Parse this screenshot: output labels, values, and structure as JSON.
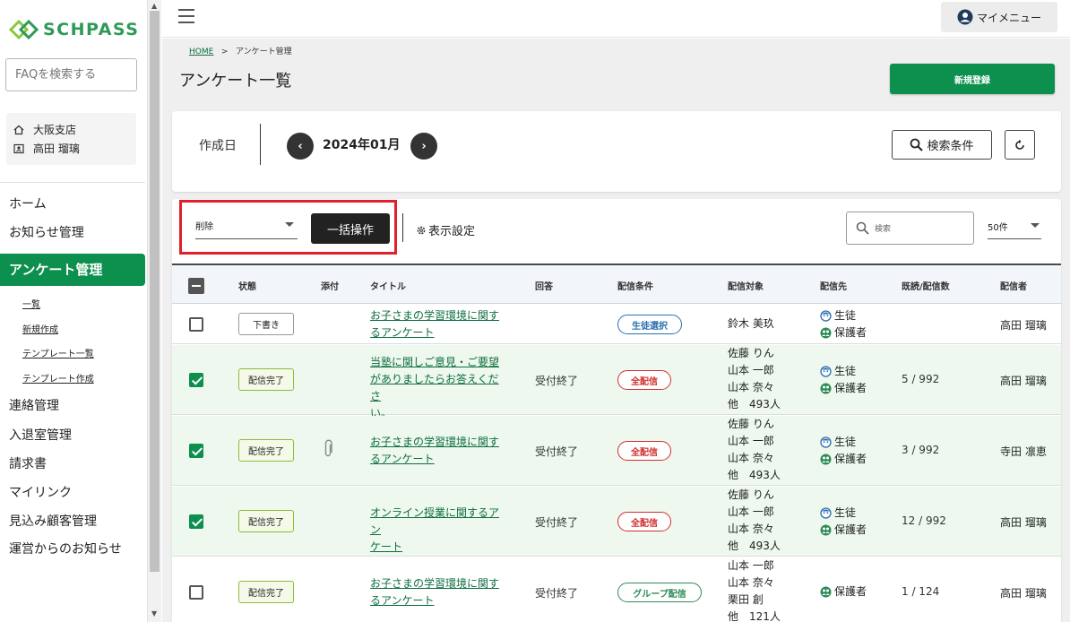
{
  "brand": {
    "name": "SCHPASS",
    "color": "#2f9a57"
  },
  "sidebar": {
    "faq_placeholder": "FAQを検索する",
    "org": {
      "branch": "大阪支店",
      "user": "高田 瑠璃"
    },
    "nav": [
      {
        "label": "ホーム"
      },
      {
        "label": "お知らせ管理"
      },
      {
        "label": "アンケート管理",
        "active": true
      },
      {
        "label": "連絡管理"
      },
      {
        "label": "入退室管理"
      },
      {
        "label": "請求書"
      },
      {
        "label": "マイリンク"
      },
      {
        "label": "見込み顧客管理"
      },
      {
        "label": "運営からのお知らせ"
      }
    ],
    "sub_nav": [
      {
        "label": "一覧"
      },
      {
        "label": "新規作成"
      },
      {
        "label": "テンプレート一覧"
      },
      {
        "label": "テンプレート作成"
      }
    ]
  },
  "topbar": {
    "my_menu_label": "マイメニュー"
  },
  "breadcrumb": {
    "home": "HOME",
    "separator": ">",
    "current": "アンケート管理"
  },
  "page": {
    "title": "アンケート一覧",
    "new_button": "新規登録",
    "accent": "#0d8f4e"
  },
  "filter": {
    "date_label": "作成日",
    "month": "2024年01月",
    "search_conditions_label": "検索条件"
  },
  "list_toolbar": {
    "bulk_action_value": "削除",
    "bulk_button": "一括操作",
    "display_settings": "表示設定",
    "search_placeholder": "検索",
    "per_page": "50件",
    "highlight_color": "#e0202a"
  },
  "table": {
    "headers": [
      "状態",
      "添付",
      "タイトル",
      "回答",
      "配信条件",
      "配信対象",
      "配信先",
      "既読/配信数",
      "配信者"
    ],
    "rows": [
      {
        "checked": false,
        "status": "下書き",
        "attachment": false,
        "title_line1": "お子さまの学習環境に関す",
        "title_line2": "るアンケート",
        "title_line3": "",
        "answer": "",
        "condition": "生徒選択",
        "targets": [
          "鈴木 美玖"
        ],
        "destinations": [
          "生徒",
          "保護者"
        ],
        "reads": "",
        "sender": "高田 瑠璃"
      },
      {
        "checked": true,
        "status": "配信完了",
        "attachment": false,
        "title_line1": "当塾に関しご意見・ご要望",
        "title_line2": "がありましたらお答えくださ",
        "title_line3": "い。",
        "answer": "受付終了",
        "condition": "全配信",
        "targets": [
          "佐藤 りん",
          "山本 一郎",
          "山本 奈々",
          "他　493人"
        ],
        "destinations": [
          "生徒",
          "保護者"
        ],
        "reads": "5 / 992",
        "sender": "高田 瑠璃"
      },
      {
        "checked": true,
        "status": "配信完了",
        "attachment": true,
        "title_line1": "お子さまの学習環境に関す",
        "title_line2": "るアンケート",
        "title_line3": "",
        "answer": "受付終了",
        "condition": "全配信",
        "targets": [
          "佐藤 りん",
          "山本 一郎",
          "山本 奈々",
          "他　493人"
        ],
        "destinations": [
          "生徒",
          "保護者"
        ],
        "reads": "3 / 992",
        "sender": "寺田 凛恵"
      },
      {
        "checked": true,
        "status": "配信完了",
        "attachment": false,
        "title_line1": "オンライン授業に関するアン",
        "title_line2": "ケート",
        "title_line3": "",
        "answer": "受付終了",
        "condition": "全配信",
        "targets": [
          "佐藤 りん",
          "山本 一郎",
          "山本 奈々",
          "他　493人"
        ],
        "destinations": [
          "生徒",
          "保護者"
        ],
        "reads": "12 / 992",
        "sender": "高田 瑠璃"
      },
      {
        "checked": false,
        "status": "配信完了",
        "attachment": false,
        "title_line1": "お子さまの学習環境に関す",
        "title_line2": "るアンケート",
        "title_line3": "",
        "answer": "受付終了",
        "condition": "グループ配信",
        "targets": [
          "山本 一郎",
          "山本 奈々",
          "栗田 創",
          "他　121人"
        ],
        "destinations": [
          "保護者"
        ],
        "reads": "1 / 124",
        "sender": "高田 瑠璃"
      }
    ]
  }
}
